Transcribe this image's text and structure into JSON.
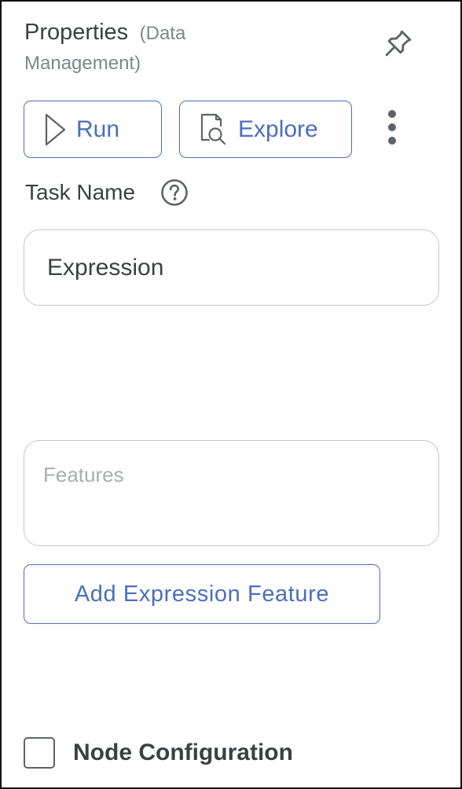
{
  "panel": {
    "title": "Properties",
    "subtitle_line1": "(Data",
    "subtitle_line2": "Management)",
    "pin_icon": "pin-icon"
  },
  "toolbar": {
    "run_label": "Run",
    "run_icon": "play-icon",
    "explore_label": "Explore",
    "explore_icon": "document-search-icon",
    "more_icon": "more-vertical-icon"
  },
  "task_name": {
    "label": "Task Name",
    "help_icon": "help-circle-icon",
    "value": "Expression"
  },
  "features": {
    "placeholder": "Features",
    "value": ""
  },
  "add_feature": {
    "label": "Add Expression Feature"
  },
  "node_configuration": {
    "label": "Node Configuration",
    "checked": false
  },
  "colors": {
    "accent": "#4a6fbd",
    "text": "#3c4043",
    "muted": "#80868b",
    "border": "#c4c7cc"
  }
}
